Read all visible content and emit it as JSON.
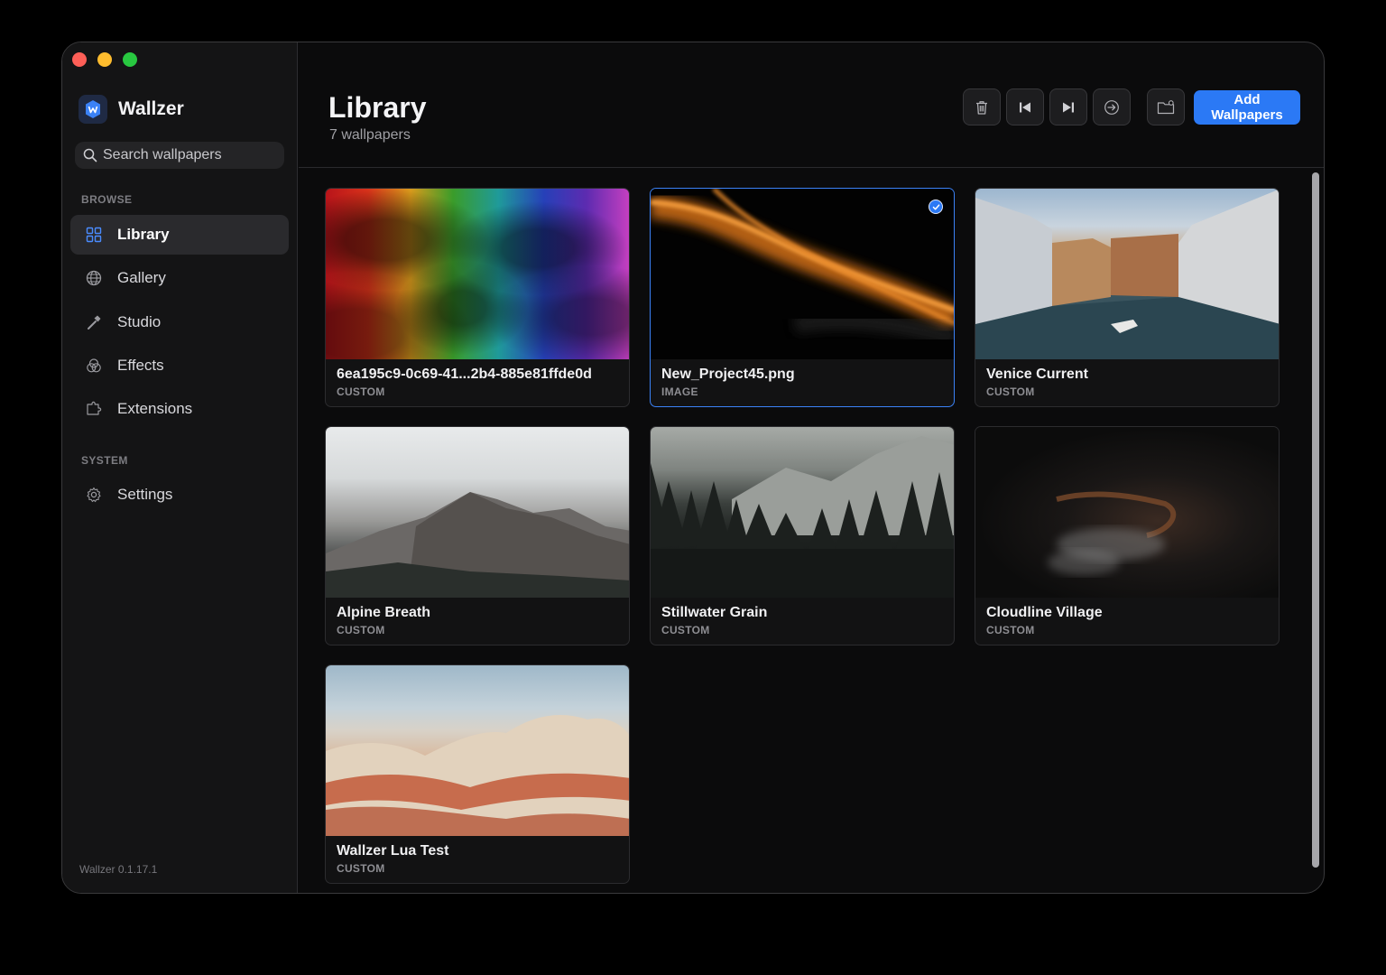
{
  "app": {
    "name": "Wallzer",
    "version": "Wallzer 0.1.17.1"
  },
  "search": {
    "placeholder": "Search wallpapers"
  },
  "sidebar": {
    "browse_label": "BROWSE",
    "system_label": "SYSTEM",
    "items": [
      {
        "label": "Library",
        "icon": "grid-icon",
        "active": true
      },
      {
        "label": "Gallery",
        "icon": "globe-icon",
        "active": false
      },
      {
        "label": "Studio",
        "icon": "hammer-icon",
        "active": false
      },
      {
        "label": "Effects",
        "icon": "effects-icon",
        "active": false
      },
      {
        "label": "Extensions",
        "icon": "puzzle-icon",
        "active": false
      }
    ],
    "system_items": [
      {
        "label": "Settings",
        "icon": "gear-icon",
        "active": false
      }
    ]
  },
  "header": {
    "title": "Library",
    "subtitle": "7 wallpapers"
  },
  "toolbar": {
    "buttons": [
      "trash-icon",
      "skip-back-icon",
      "skip-forward-icon",
      "arrow-circle-icon",
      "folder-icon"
    ],
    "add_label": "Add Wallpapers"
  },
  "colors": {
    "accent": "#2b79f5",
    "background": "#0b0b0c",
    "sidebar": "#141415"
  },
  "wallpapers": [
    {
      "title": "6ea195c9-0c69-41...2b4-885e81ffde0d",
      "type": "CUSTOM",
      "selected": false
    },
    {
      "title": "New_Project45.png",
      "type": "IMAGE",
      "selected": true
    },
    {
      "title": "Venice Current",
      "type": "CUSTOM",
      "selected": false
    },
    {
      "title": "Alpine Breath",
      "type": "CUSTOM",
      "selected": false
    },
    {
      "title": "Stillwater Grain",
      "type": "CUSTOM",
      "selected": false
    },
    {
      "title": "Cloudline Village",
      "type": "CUSTOM",
      "selected": false
    },
    {
      "title": "Wallzer Lua Test",
      "type": "CUSTOM",
      "selected": false
    }
  ]
}
